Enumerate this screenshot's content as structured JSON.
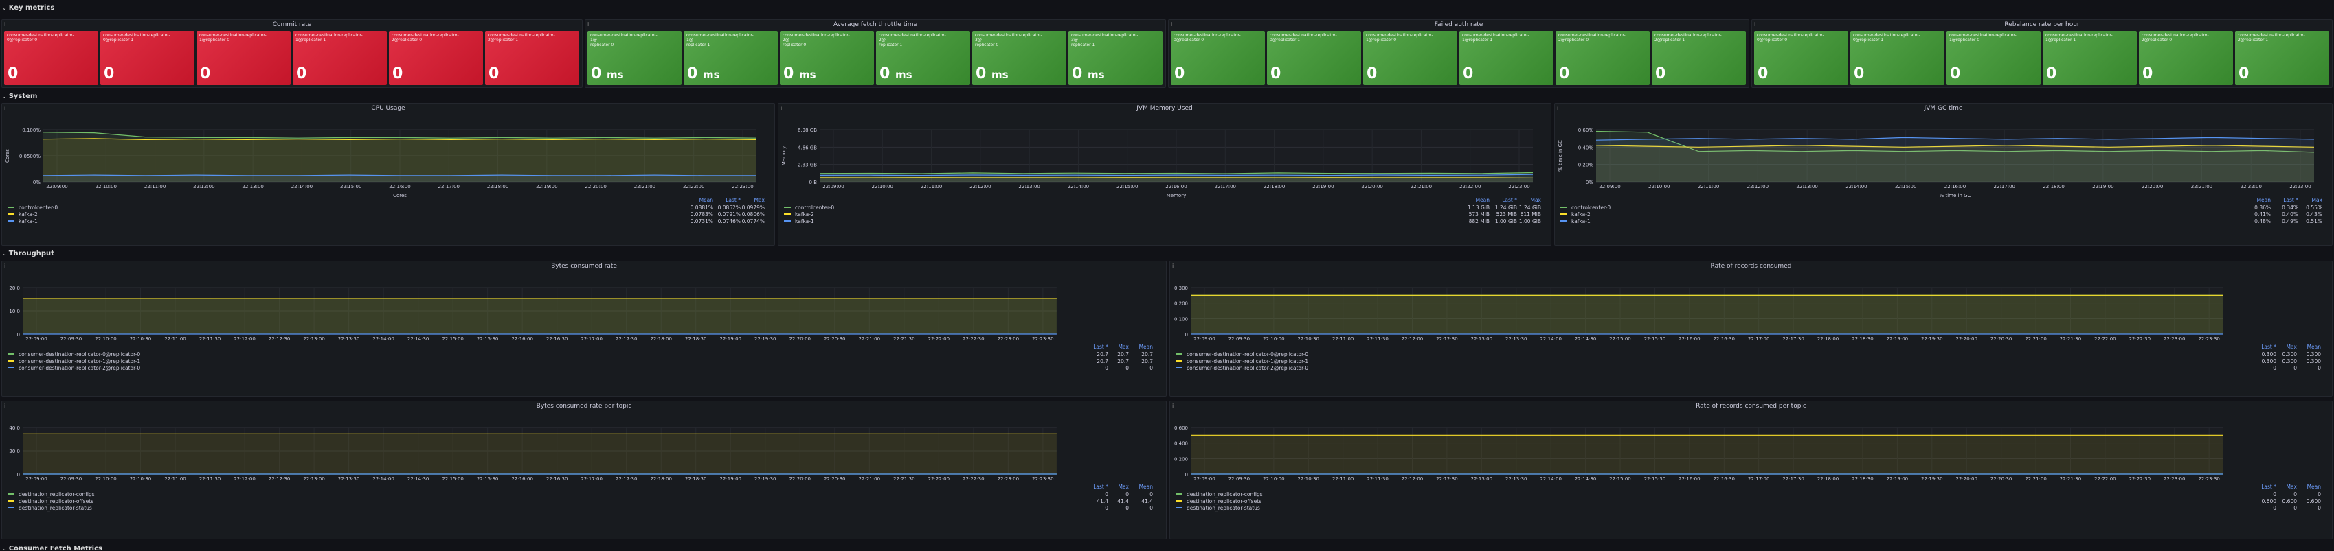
{
  "rows": {
    "key_metrics": "Key metrics",
    "system": "System",
    "throughput": "Throughput",
    "consumer_fetch": "Consumer Fetch Metrics"
  },
  "stat_groups": [
    {
      "title": "Commit rate",
      "color": "red",
      "unit": "",
      "items": [
        {
          "label": "consumer-destination-replicator-\n0@replicator-0",
          "value": "0"
        },
        {
          "label": "consumer-destination-replicator-\n0@replicator-1",
          "value": "0"
        },
        {
          "label": "consumer-destination-replicator-\n1@replicator-0",
          "value": "0"
        },
        {
          "label": "consumer-destination-replicator-\n1@replicator-1",
          "value": "0"
        },
        {
          "label": "consumer-destination-replicator-\n2@replicator-0",
          "value": "0"
        },
        {
          "label": "consumer-destination-replicator-\n2@replicator-1",
          "value": "0"
        }
      ]
    },
    {
      "title": "Average fetch throttle time",
      "color": "green",
      "unit": "ms",
      "items": [
        {
          "label": "consumer-destination-replicator-\n1@\nreplicator-0",
          "value": "0"
        },
        {
          "label": "consumer-destination-replicator-\n1@\nreplicator-1",
          "value": "0"
        },
        {
          "label": "consumer-destination-replicator-\n2@\nreplicator-0",
          "value": "0"
        },
        {
          "label": "consumer-destination-replicator-\n2@\nreplicator-1",
          "value": "0"
        },
        {
          "label": "consumer-destination-replicator-\n3@\nreplicator-0",
          "value": "0"
        },
        {
          "label": "consumer-destination-replicator-\n3@\nreplicator-1",
          "value": "0"
        }
      ]
    },
    {
      "title": "Failed auth rate",
      "color": "green",
      "unit": "",
      "items": [
        {
          "label": "consumer-destination-replicator-\n0@replicator-0",
          "value": "0"
        },
        {
          "label": "consumer-destination-replicator-\n0@replicator-1",
          "value": "0"
        },
        {
          "label": "consumer-destination-replicator-\n1@replicator-0",
          "value": "0"
        },
        {
          "label": "consumer-destination-replicator-\n1@replicator-1",
          "value": "0"
        },
        {
          "label": "consumer-destination-replicator-\n2@replicator-0",
          "value": "0"
        },
        {
          "label": "consumer-destination-replicator-\n2@replicator-1",
          "value": "0"
        }
      ]
    },
    {
      "title": "Rebalance rate per hour",
      "color": "green",
      "unit": "",
      "items": [
        {
          "label": "consumer-destination-replicator-\n0@replicator-0",
          "value": "0"
        },
        {
          "label": "consumer-destination-replicator-\n0@replicator-1",
          "value": "0"
        },
        {
          "label": "consumer-destination-replicator-\n1@replicator-0",
          "value": "0"
        },
        {
          "label": "consumer-destination-replicator-\n1@replicator-1",
          "value": "0"
        },
        {
          "label": "consumer-destination-replicator-\n2@replicator-0",
          "value": "0"
        },
        {
          "label": "consumer-destination-replicator-\n2@replicator-1",
          "value": "0"
        }
      ]
    }
  ],
  "colors": {
    "green": "#73bf69",
    "yellow": "#fade2a",
    "blue": "#5794f2",
    "orange": "#ff9830",
    "red": "#f2495c",
    "bg": "#111217",
    "panel": "#181b1f"
  },
  "chart_data": [
    {
      "id": "cpu",
      "type": "line",
      "title": "CPU Usage",
      "ylabel": "Cores",
      "xlabel": "Cores",
      "x": [
        "22:09:00",
        "22:10:00",
        "22:11:00",
        "22:12:00",
        "22:13:00",
        "22:14:00",
        "22:15:00",
        "22:16:00",
        "22:17:00",
        "22:18:00",
        "22:19:00",
        "22:20:00",
        "22:21:00",
        "22:22:00",
        "22:23:00"
      ],
      "ticks": [
        "0.100%",
        "0.0500%",
        "0%"
      ],
      "ylim": [
        0,
        0.1
      ],
      "legend_headers": [
        "Mean",
        "Last *",
        "Max"
      ],
      "series": [
        {
          "name": "controlcenter-0",
          "color": "#73bf69",
          "values": [
            0.095,
            0.094,
            0.086,
            0.085,
            0.085,
            0.084,
            0.085,
            0.085,
            0.084,
            0.085,
            0.084,
            0.085,
            0.084,
            0.085,
            0.084
          ],
          "stats": [
            "0.0881%",
            "0.0852%",
            "0.0979%"
          ]
        },
        {
          "name": "kafka-2",
          "color": "#fade2a",
          "values": [
            0.082,
            0.083,
            0.081,
            0.082,
            0.081,
            0.082,
            0.081,
            0.082,
            0.081,
            0.082,
            0.081,
            0.082,
            0.081,
            0.082,
            0.081
          ],
          "stats": [
            "0.0783%",
            "0.0791%",
            "0.0806%"
          ]
        },
        {
          "name": "kafka-1",
          "color": "#5794f2",
          "values": [
            0.012,
            0.013,
            0.012,
            0.013,
            0.012,
            0.012,
            0.013,
            0.012,
            0.012,
            0.013,
            0.012,
            0.012,
            0.013,
            0.012,
            0.012
          ],
          "stats": [
            "0.0731%",
            "0.0746%",
            "0.0774%"
          ]
        }
      ]
    },
    {
      "id": "jvm_mem",
      "type": "line",
      "title": "JVM Memory Used",
      "ylabel": "Memory",
      "xlabel": "Memory",
      "x": [
        "22:09:00",
        "22:10:00",
        "22:11:00",
        "22:12:00",
        "22:13:00",
        "22:14:00",
        "22:15:00",
        "22:16:00",
        "22:17:00",
        "22:18:00",
        "22:19:00",
        "22:20:00",
        "22:21:00",
        "22:22:00",
        "22:23:00"
      ],
      "ticks": [
        "6.98 GB",
        "4.66 GB",
        "2.33 GB",
        "0 B"
      ],
      "ylim": [
        0,
        6.98
      ],
      "legend_headers": [
        "Mean",
        "Last *",
        "Max"
      ],
      "series": [
        {
          "name": "controlcenter-0",
          "color": "#73bf69",
          "values": [
            1.13,
            1.15,
            1.1,
            1.2,
            1.12,
            1.18,
            1.13,
            1.15,
            1.1,
            1.2,
            1.14,
            1.13,
            1.16,
            1.12,
            1.24
          ],
          "stats": [
            "1.13 GiB",
            "1.24 GiB",
            "1.24 GiB"
          ]
        },
        {
          "name": "kafka-2",
          "color": "#fade2a",
          "values": [
            0.57,
            0.55,
            0.58,
            0.56,
            0.57,
            0.55,
            0.58,
            0.56,
            0.57,
            0.55,
            0.58,
            0.56,
            0.57,
            0.56,
            0.52
          ],
          "stats": [
            "573 MiB",
            "523 MiB",
            "611 MiB"
          ]
        },
        {
          "name": "kafka-1",
          "color": "#5794f2",
          "values": [
            0.88,
            0.9,
            0.86,
            0.92,
            0.88,
            0.9,
            0.87,
            0.91,
            0.88,
            0.9,
            0.86,
            0.92,
            0.88,
            0.9,
            1.0
          ],
          "stats": [
            "882 MiB",
            "1.00 GiB",
            "1.00 GiB"
          ]
        }
      ]
    },
    {
      "id": "jvm_gc",
      "type": "line",
      "title": "JVM GC time",
      "ylabel": "% time in GC",
      "xlabel": "% time in GC",
      "x": [
        "22:09:00",
        "22:10:00",
        "22:11:00",
        "22:12:00",
        "22:13:00",
        "22:14:00",
        "22:15:00",
        "22:16:00",
        "22:17:00",
        "22:18:00",
        "22:19:00",
        "22:20:00",
        "22:21:00",
        "22:22:00",
        "22:23:00"
      ],
      "ticks": [
        "0.60%",
        "0.40%",
        "0.20%",
        "0%"
      ],
      "ylim": [
        0,
        0.6
      ],
      "legend_headers": [
        "Mean",
        "Last *",
        "Max"
      ],
      "series": [
        {
          "name": "controlcenter-0",
          "color": "#73bf69",
          "values": [
            0.58,
            0.57,
            0.35,
            0.36,
            0.35,
            0.36,
            0.35,
            0.36,
            0.35,
            0.36,
            0.35,
            0.36,
            0.35,
            0.36,
            0.34
          ],
          "stats": [
            "0.36%",
            "0.34%",
            "0.55%"
          ]
        },
        {
          "name": "kafka-2",
          "color": "#fade2a",
          "values": [
            0.42,
            0.41,
            0.4,
            0.41,
            0.42,
            0.41,
            0.4,
            0.41,
            0.42,
            0.41,
            0.4,
            0.41,
            0.42,
            0.41,
            0.4
          ],
          "stats": [
            "0.41%",
            "0.40%",
            "0.43%"
          ]
        },
        {
          "name": "kafka-1",
          "color": "#5794f2",
          "values": [
            0.48,
            0.49,
            0.5,
            0.49,
            0.5,
            0.49,
            0.51,
            0.5,
            0.49,
            0.5,
            0.49,
            0.5,
            0.51,
            0.5,
            0.49
          ],
          "stats": [
            "0.48%",
            "0.49%",
            "0.51%"
          ]
        }
      ]
    },
    {
      "id": "bytes_consumed",
      "type": "line",
      "title": "Bytes consumed rate",
      "ticks": [
        "20.0",
        "10.0",
        "0"
      ],
      "ylim": [
        0,
        27
      ],
      "x": [
        "22:09:00",
        "22:09:30",
        "22:10:00",
        "22:10:30",
        "22:11:00",
        "22:11:30",
        "22:12:00",
        "22:12:30",
        "22:13:00",
        "22:13:30",
        "22:14:00",
        "22:14:30",
        "22:15:00",
        "22:15:30",
        "22:16:00",
        "22:16:30",
        "22:17:00",
        "22:17:30",
        "22:18:00",
        "22:18:30",
        "22:19:00",
        "22:19:30",
        "22:20:00",
        "22:20:30",
        "22:21:00",
        "22:21:30",
        "22:22:00",
        "22:22:30",
        "22:23:00",
        "22:23:30"
      ],
      "legend_headers": [
        "Last *",
        "Max",
        "Mean"
      ],
      "series": [
        {
          "name": "consumer-destination-replicator-0@replicator-0",
          "color": "#73bf69",
          "values": [
            20.7,
            20.7
          ],
          "stats": [
            "20.7",
            "20.7",
            "20.7"
          ]
        },
        {
          "name": "consumer-destination-replicator-1@replicator-1",
          "color": "#fade2a",
          "values": [
            20.7,
            20.7
          ],
          "stats": [
            "20.7",
            "20.7",
            "20.7"
          ]
        },
        {
          "name": "consumer-destination-replicator-2@replicator-0",
          "color": "#5794f2",
          "values": [
            0,
            0
          ],
          "stats": [
            "0",
            "0",
            "0"
          ]
        }
      ]
    },
    {
      "id": "records_consumed",
      "type": "line",
      "title": "Rate of records consumed",
      "ticks": [
        "0.300",
        "0.200",
        "0.100",
        "0"
      ],
      "ylim": [
        0,
        0.36
      ],
      "x": [
        "22:09:00",
        "22:09:30",
        "22:10:00",
        "22:10:30",
        "22:11:00",
        "22:11:30",
        "22:12:00",
        "22:12:30",
        "22:13:00",
        "22:13:30",
        "22:14:00",
        "22:14:30",
        "22:15:00",
        "22:15:30",
        "22:16:00",
        "22:16:30",
        "22:17:00",
        "22:17:30",
        "22:18:00",
        "22:18:30",
        "22:19:00",
        "22:19:30",
        "22:20:00",
        "22:20:30",
        "22:21:00",
        "22:21:30",
        "22:22:00",
        "22:22:30",
        "22:23:00",
        "22:23:30"
      ],
      "legend_headers": [
        "Last *",
        "Max",
        "Mean"
      ],
      "series": [
        {
          "name": "consumer-destination-replicator-0@replicator-0",
          "color": "#73bf69",
          "values": [
            0.3,
            0.3
          ],
          "stats": [
            "0.300",
            "0.300",
            "0.300"
          ]
        },
        {
          "name": "consumer-destination-replicator-1@replicator-1",
          "color": "#fade2a",
          "values": [
            0.3,
            0.3
          ],
          "stats": [
            "0.300",
            "0.300",
            "0.300"
          ]
        },
        {
          "name": "consumer-destination-replicator-2@replicator-0",
          "color": "#5794f2",
          "values": [
            0,
            0
          ],
          "stats": [
            "0",
            "0",
            "0"
          ]
        }
      ]
    },
    {
      "id": "bytes_per_topic",
      "type": "line",
      "title": "Bytes consumed rate per topic",
      "ticks": [
        "40.0",
        "20.0",
        "0"
      ],
      "ylim": [
        0,
        48
      ],
      "x": [
        "22:09:00",
        "22:09:30",
        "22:10:00",
        "22:10:30",
        "22:11:00",
        "22:11:30",
        "22:12:00",
        "22:12:30",
        "22:13:00",
        "22:13:30",
        "22:14:00",
        "22:14:30",
        "22:15:00",
        "22:15:30",
        "22:16:00",
        "22:16:30",
        "22:17:00",
        "22:17:30",
        "22:18:00",
        "22:18:30",
        "22:19:00",
        "22:19:30",
        "22:20:00",
        "22:20:30",
        "22:21:00",
        "22:21:30",
        "22:22:00",
        "22:22:30",
        "22:23:00",
        "22:23:30"
      ],
      "legend_headers": [
        "Last *",
        "Max",
        "Mean"
      ],
      "series": [
        {
          "name": "destination_replicator-configs",
          "color": "#73bf69",
          "values": [
            0,
            0
          ],
          "stats": [
            "0",
            "0",
            "0"
          ]
        },
        {
          "name": "destination_replicator-offsets",
          "color": "#fade2a",
          "values": [
            41.4,
            41.4
          ],
          "stats": [
            "41.4",
            "41.4",
            "41.4"
          ]
        },
        {
          "name": "destination_replicator-status",
          "color": "#5794f2",
          "values": [
            0,
            0
          ],
          "stats": [
            "0",
            "0",
            "0"
          ]
        }
      ]
    },
    {
      "id": "records_per_topic",
      "type": "line",
      "title": "Rate of records consumed per topic",
      "ticks": [
        "0.600",
        "0.400",
        "0.200",
        "0"
      ],
      "ylim": [
        0,
        0.72
      ],
      "x": [
        "22:09:00",
        "22:09:30",
        "22:10:00",
        "22:10:30",
        "22:11:00",
        "22:11:30",
        "22:12:00",
        "22:12:30",
        "22:13:00",
        "22:13:30",
        "22:14:00",
        "22:14:30",
        "22:15:00",
        "22:15:30",
        "22:16:00",
        "22:16:30",
        "22:17:00",
        "22:17:30",
        "22:18:00",
        "22:18:30",
        "22:19:00",
        "22:19:30",
        "22:20:00",
        "22:20:30",
        "22:21:00",
        "22:21:30",
        "22:22:00",
        "22:22:30",
        "22:23:00",
        "22:23:30"
      ],
      "legend_headers": [
        "Last *",
        "Max",
        "Mean"
      ],
      "series": [
        {
          "name": "destination_replicator-configs",
          "color": "#73bf69",
          "values": [
            0,
            0
          ],
          "stats": [
            "0",
            "0",
            "0"
          ]
        },
        {
          "name": "destination_replicator-offsets",
          "color": "#fade2a",
          "values": [
            0.6,
            0.6
          ],
          "stats": [
            "0.600",
            "0.600",
            "0.600"
          ]
        },
        {
          "name": "destination_replicator-status",
          "color": "#5794f2",
          "values": [
            0,
            0
          ],
          "stats": [
            "0",
            "0",
            "0"
          ]
        }
      ]
    }
  ]
}
